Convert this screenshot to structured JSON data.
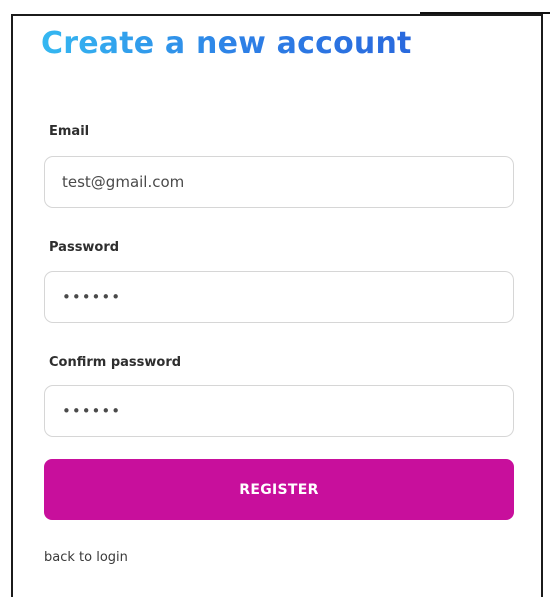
{
  "form": {
    "title": "Create a new account",
    "email": {
      "label": "Email",
      "value": "test@gmail.com",
      "placeholder": ""
    },
    "password": {
      "label": "Password",
      "value": "••••••"
    },
    "confirm_password": {
      "label": "Confirm password",
      "value": "••••••"
    },
    "register_label": "REGISTER",
    "back_link_label": "back to login"
  },
  "colors": {
    "title_gradient_start": "#35b8f1",
    "title_gradient_end": "#2a69dd",
    "register_button": "#c80f9c",
    "input_border": "#d6d6d6"
  }
}
